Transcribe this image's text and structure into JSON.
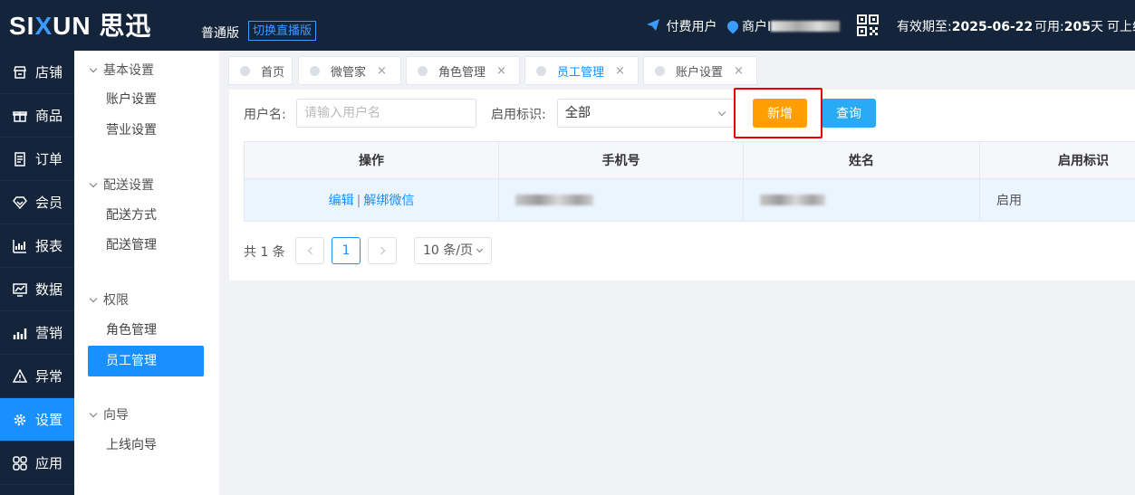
{
  "header": {
    "logo_prefix": "SI",
    "logo_x": "X",
    "logo_rest": "UN 思迅",
    "edition": "普通版",
    "switch_label": "切换直播版",
    "paid_user": "付费用户",
    "merchant_prefix": "商户I",
    "expiry_label": "有效期至:",
    "expiry_date": "2025-06-22",
    "available_label": "可用:",
    "available_days": "205",
    "available_unit": "天",
    "cut_text": "可上线"
  },
  "leftnav": {
    "items": [
      {
        "label": "店铺",
        "icon": "store-icon"
      },
      {
        "label": "商品",
        "icon": "gift-icon"
      },
      {
        "label": "订单",
        "icon": "order-icon"
      },
      {
        "label": "会员",
        "icon": "member-icon"
      },
      {
        "label": "报表",
        "icon": "report-icon"
      },
      {
        "label": "数据",
        "icon": "data-icon"
      },
      {
        "label": "营销",
        "icon": "marketing-icon"
      },
      {
        "label": "异常",
        "icon": "warning-icon"
      },
      {
        "label": "设置",
        "icon": "gear-icon",
        "active": true
      },
      {
        "label": "应用",
        "icon": "apps-icon"
      }
    ]
  },
  "submenu": {
    "groups": [
      {
        "title": "基本设置",
        "items": [
          "账户设置",
          "营业设置"
        ]
      },
      {
        "title": "配送设置",
        "items": [
          "配送方式",
          "配送管理"
        ]
      },
      {
        "title": "权限",
        "items": [
          "角色管理",
          "员工管理"
        ]
      },
      {
        "title": "向导",
        "items": [
          "上线向导"
        ]
      }
    ],
    "active_item": "员工管理"
  },
  "tabs": [
    {
      "label": "首页",
      "closable": false
    },
    {
      "label": "微管家",
      "closable": true
    },
    {
      "label": "角色管理",
      "closable": true
    },
    {
      "label": "员工管理",
      "closable": true,
      "active": true
    },
    {
      "label": "账户设置",
      "closable": true
    }
  ],
  "tab_close_glyph": "×",
  "filters": {
    "username_label": "用户名:",
    "username_placeholder": "请输入用户名",
    "username_value": "",
    "status_label": "启用标识:",
    "status_value": "全部",
    "add_label": "新增",
    "query_label": "查询"
  },
  "table": {
    "columns": [
      "操作",
      "手机号",
      "姓名",
      "启用标识"
    ],
    "rows": [
      {
        "edit": "编辑",
        "sep": "|",
        "unbind": "解绑微信",
        "phone_visible": "",
        "name_visible": "",
        "status": "启用"
      }
    ]
  },
  "pagination": {
    "total": "共 1 条",
    "current_page": "1",
    "page_size": "10 条/页"
  },
  "colors": {
    "topbar": "#14243a",
    "primary": "#1890ff",
    "add_button": "#ff9e00",
    "query_button": "#29aaf4",
    "highlight_box": "#e60000"
  }
}
